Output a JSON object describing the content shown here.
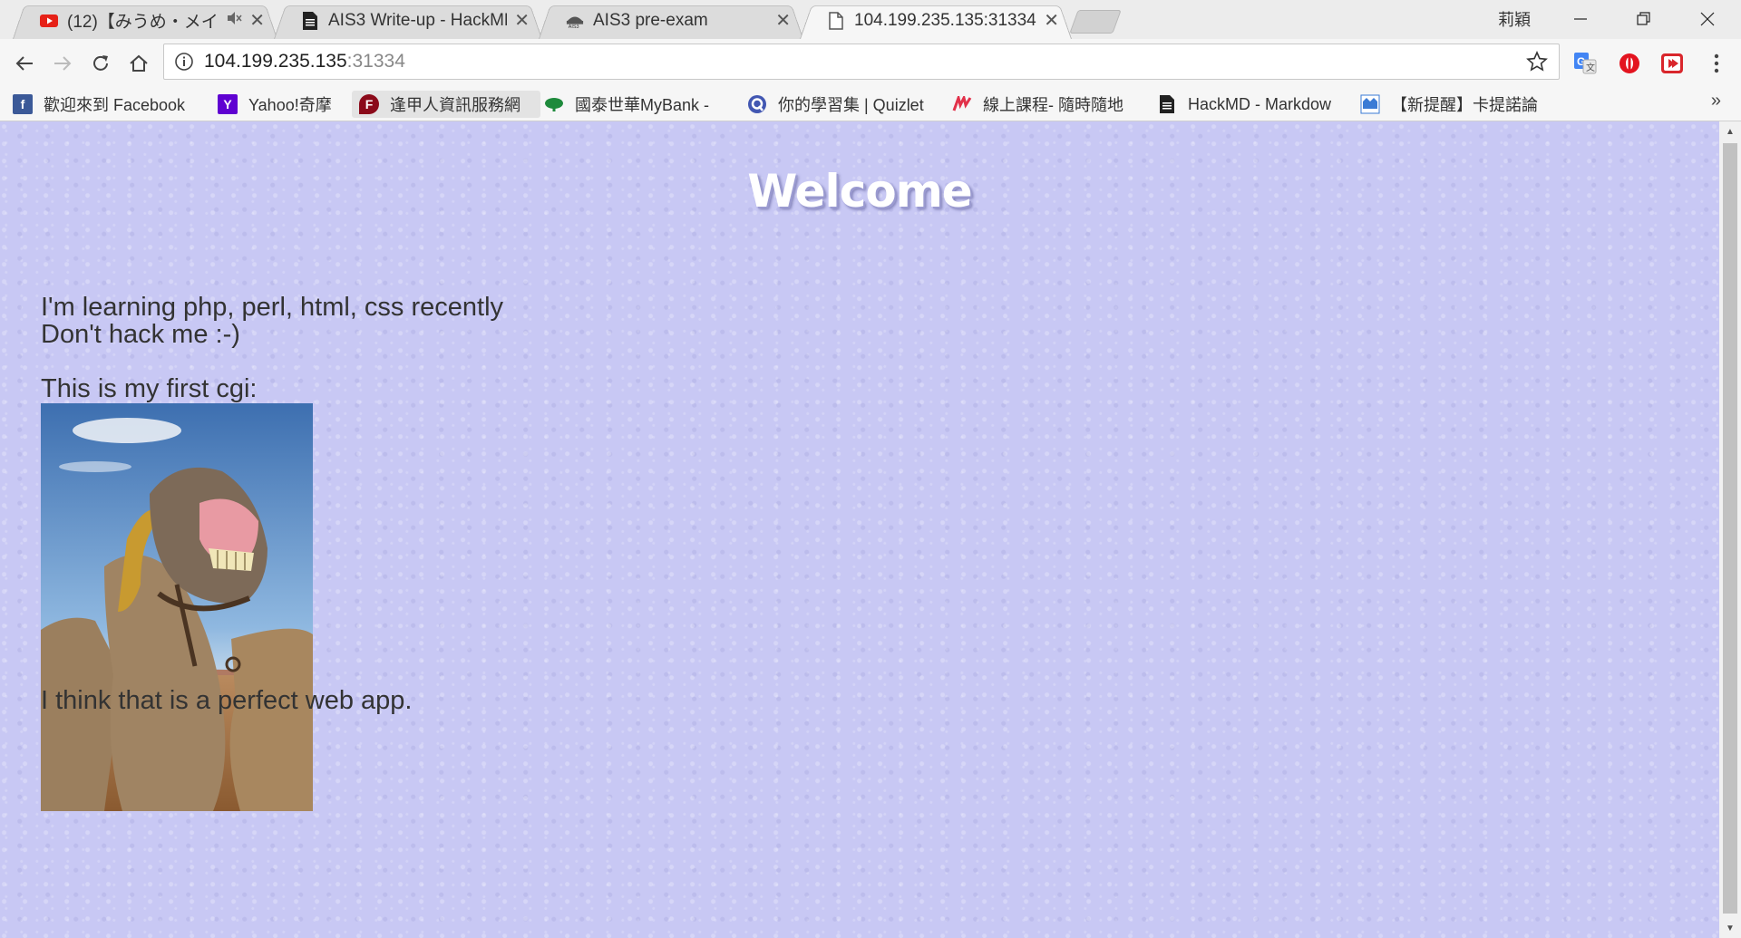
{
  "tabs": [
    {
      "title": "(12)【みうめ・メイ",
      "icon": "youtube-icon",
      "muted": true
    },
    {
      "title": "AIS3 Write-up - HackMD",
      "icon": "document-icon"
    },
    {
      "title": "AIS3 pre-exam",
      "icon": "ais3-icon"
    },
    {
      "title": "104.199.235.135:31334",
      "icon": "page-icon",
      "active": true
    }
  ],
  "window": {
    "profile": "莉穎"
  },
  "omnibox": {
    "host": "104.199.235.135",
    "port": ":31334"
  },
  "bookmarks": [
    {
      "label": "歡迎來到 Facebook",
      "icon": "facebook-icon",
      "color": "#3b5998"
    },
    {
      "label": "Yahoo!奇摩",
      "icon": "yahoo-icon",
      "color": "#5f01d1"
    },
    {
      "label": "逢甲人資訊服務網",
      "icon": "fcu-icon",
      "color": "#8b0a1a"
    },
    {
      "label": "國泰世華MyBank - ",
      "icon": "cathay-icon",
      "color": "#1e8a3c"
    },
    {
      "label": "你的學習集 | Quizlet",
      "icon": "quizlet-icon",
      "color": "#4257b2"
    },
    {
      "label": "線上課程- 隨時隨地",
      "icon": "hahow-icon",
      "color": "#e2314a"
    },
    {
      "label": "HackMD - Markdow",
      "icon": "hackmd-icon",
      "color": "#222222"
    },
    {
      "label": "【新提醒】卡提諾論",
      "icon": "ck101-icon",
      "color": "#3a7bd5"
    }
  ],
  "page": {
    "heading": "Welcome",
    "line1": "I'm learning php, perl, html, css recently",
    "line2": "Don't hack me :-)",
    "line3": "This is my first cgi:",
    "line4": "I think that is a perfect web app."
  },
  "colors": {
    "page_bg": "#c8c8f4",
    "text": "#333333"
  }
}
